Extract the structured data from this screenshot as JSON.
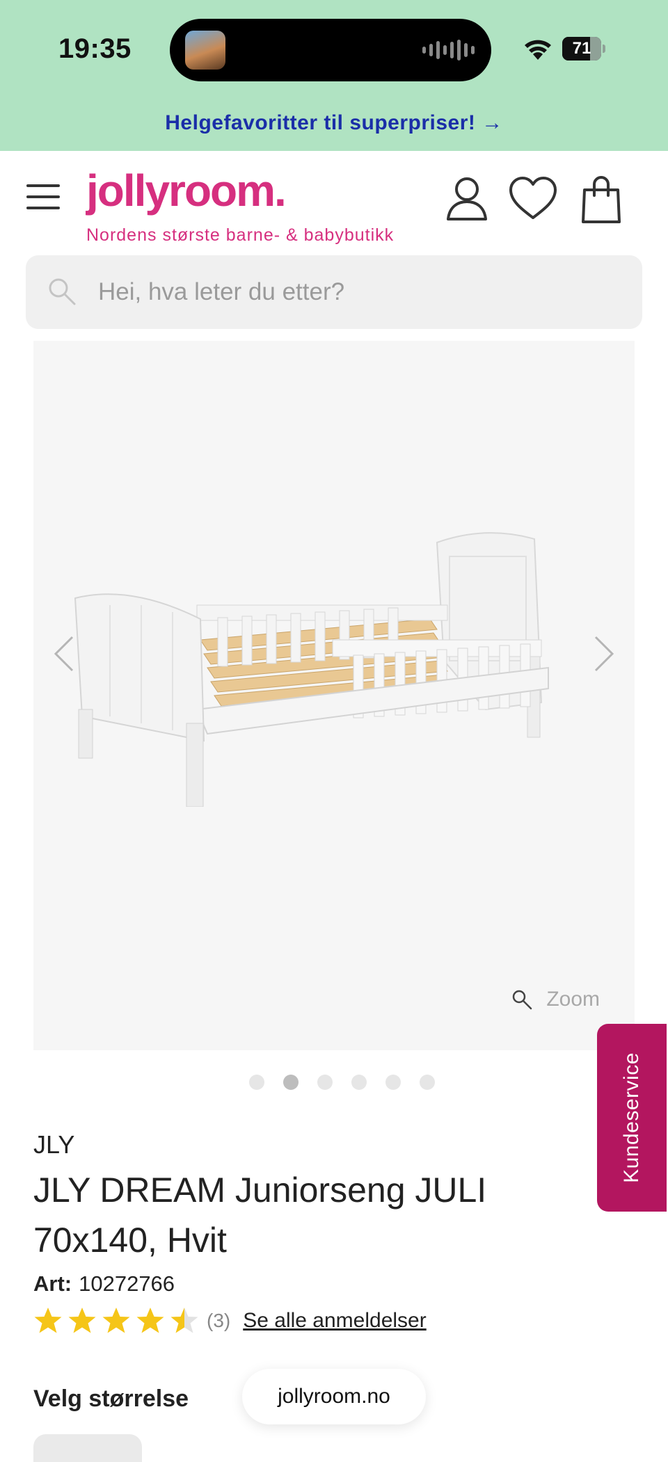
{
  "status_bar": {
    "time": "19:35",
    "battery_percent": "71",
    "battery_level": 0.71
  },
  "promo": {
    "text": "Helgefavoritter til superpriser! →"
  },
  "header": {
    "logo": "jollyroom.",
    "tagline": "Nordens største barne- & babybutikk",
    "icons": [
      "menu-icon",
      "account-icon",
      "heart-icon",
      "cart-icon"
    ]
  },
  "search": {
    "placeholder": "Hei, hva leter du etter?"
  },
  "gallery": {
    "zoom_label": "Zoom",
    "slide_count": 6,
    "active_slide": 2
  },
  "side_tab": {
    "label": "Kundeservice"
  },
  "product": {
    "brand": "JLY",
    "title": "JLY DREAM Juniorseng JULI 70x140, Hvit",
    "art_label": "Art:",
    "art_number": "10272766",
    "rating": 4.5,
    "review_count": "(3)",
    "review_link": "Se alle anmeldelser"
  },
  "size": {
    "label": "Velg størrelse"
  },
  "browser": {
    "url": "jollyroom.no"
  },
  "colors": {
    "topband": "#b0e3c2",
    "promo_text": "#1a2ea8",
    "brand_pink": "#d62f7f",
    "kundeservice": "#b3165f",
    "star": "#f5c518"
  }
}
